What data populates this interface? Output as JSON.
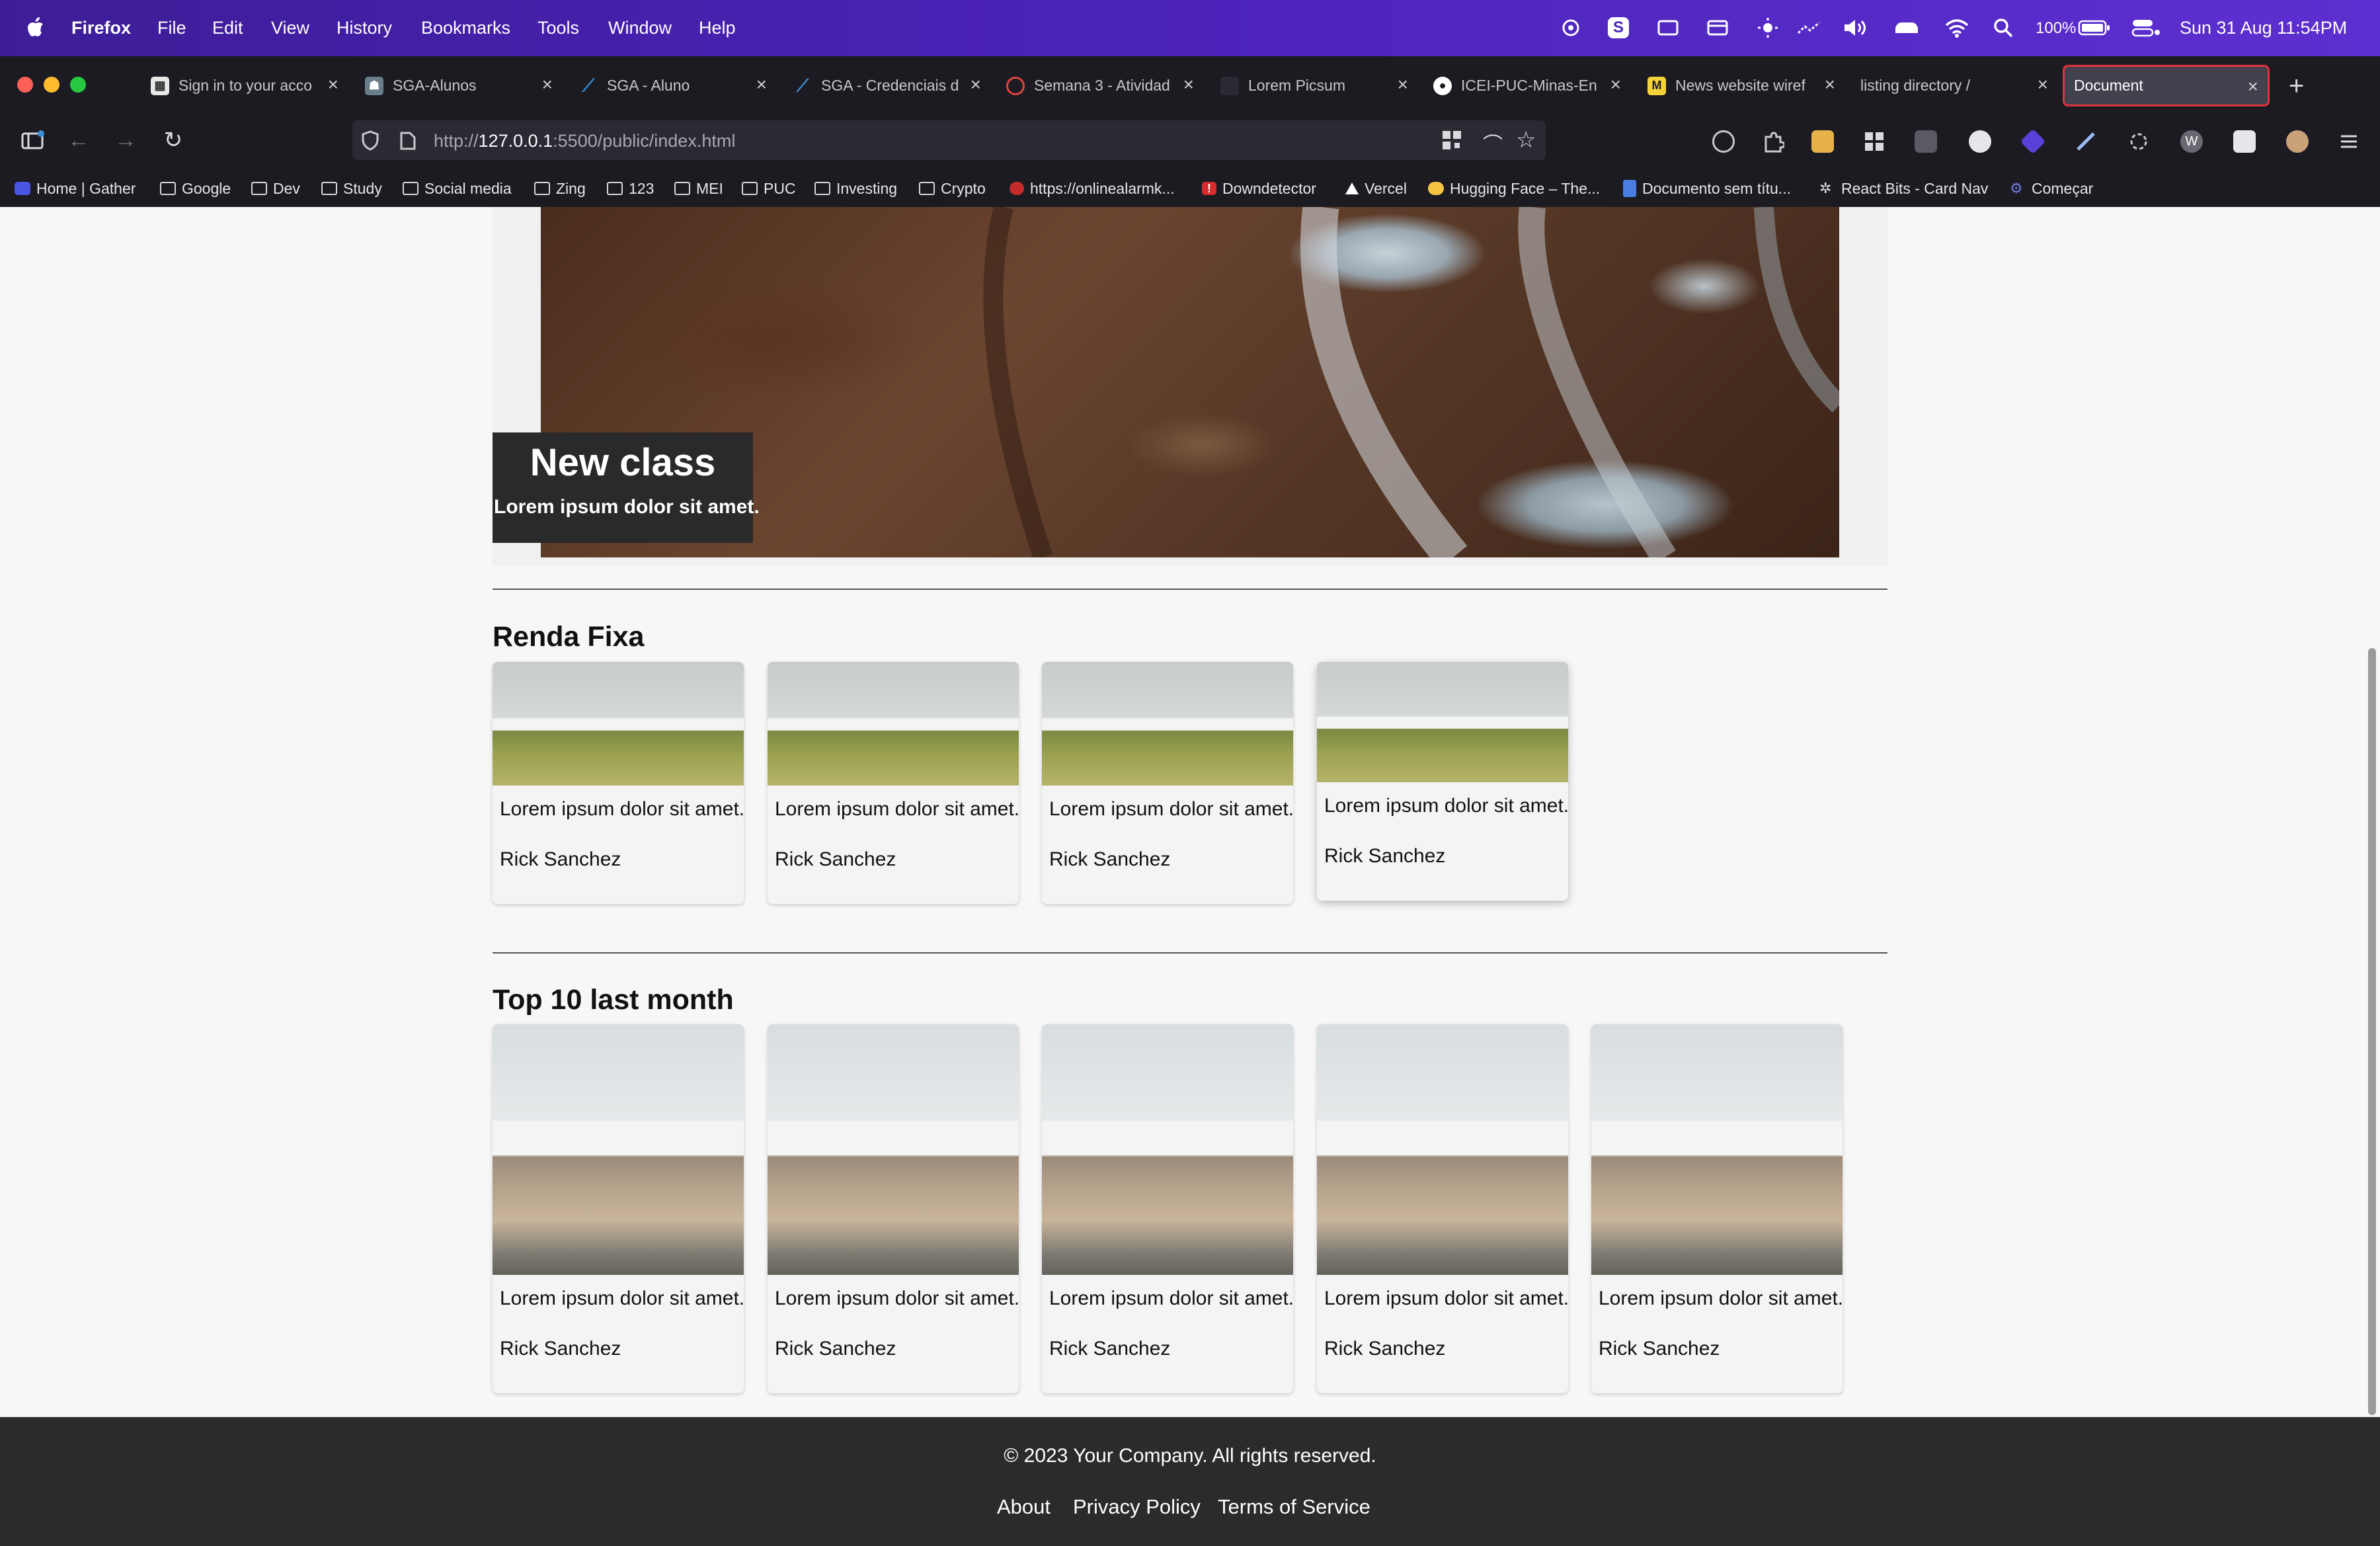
{
  "menubar": {
    "app_name": "Firefox",
    "items": [
      "File",
      "Edit",
      "View",
      "History",
      "Bookmarks",
      "Tools",
      "Window",
      "Help"
    ],
    "battery": "100%",
    "datetime": "Sun 31 Aug  11:54PM"
  },
  "tabs": [
    {
      "title": "Sign in to your acco",
      "favicon_color": "#e8e8e8",
      "active": false
    },
    {
      "title": "SGA-Alunos",
      "favicon_color": "#6a7d8a",
      "active": false
    },
    {
      "title": "SGA - Aluno",
      "favicon_color": "#3a8fd9",
      "active": false
    },
    {
      "title": "SGA - Credenciais d",
      "favicon_color": "#3a8fd9",
      "active": false
    },
    {
      "title": "Semana 3 - Atividad",
      "favicon_color": "#e0463b",
      "active": false
    },
    {
      "title": "Lorem Picsum",
      "favicon_color": "#1c1b22",
      "active": false
    },
    {
      "title": "ICEI-PUC-Minas-En",
      "favicon_color": "#ffffff",
      "active": false
    },
    {
      "title": "News website wiref",
      "favicon_color": "#f5d23a",
      "active": false
    },
    {
      "title": "listing directory /",
      "favicon_color": "#1c1b22",
      "active": false
    },
    {
      "title": "Document",
      "favicon_color": "#1c1b22",
      "active": true
    }
  ],
  "url": {
    "prefix": "http://",
    "host": "127.0.0.1",
    "rest": ":5500/public/index.html"
  },
  "bookmarks": [
    {
      "label": "Home | Gather",
      "icon": "gather-icon",
      "color": "#4a56e2"
    },
    {
      "label": "Google",
      "icon": "folder-icon"
    },
    {
      "label": "Dev",
      "icon": "folder-icon"
    },
    {
      "label": "Study",
      "icon": "folder-icon"
    },
    {
      "label": "Social media",
      "icon": "folder-icon"
    },
    {
      "label": "Zing",
      "icon": "folder-icon"
    },
    {
      "label": "123",
      "icon": "folder-icon"
    },
    {
      "label": "MEI",
      "icon": "folder-icon"
    },
    {
      "label": "PUC",
      "icon": "folder-icon"
    },
    {
      "label": "Investing",
      "icon": "folder-icon"
    },
    {
      "label": "Crypto",
      "icon": "folder-icon"
    },
    {
      "label": "https://onlinealarmk...",
      "icon": "alarm-icon",
      "color": "#c42b2b"
    },
    {
      "label": "Downdetector",
      "icon": "alert-icon",
      "color": "#d92b2b"
    },
    {
      "label": "Vercel",
      "icon": "vercel-icon",
      "color": "#ffffff"
    },
    {
      "label": "Hugging Face – The...",
      "icon": "hugging-face-icon",
      "color": "#f5c542"
    },
    {
      "label": "Documento sem títu...",
      "icon": "docs-icon",
      "color": "#4a7de2"
    },
    {
      "label": "React Bits - Card Nav",
      "icon": "react-bits-icon",
      "color": "#dddddd"
    },
    {
      "label": "Começar",
      "icon": "gear-icon",
      "color": "#6b7cd9"
    }
  ],
  "hero": {
    "title": "New class",
    "subtitle": "Lorem ipsum dolor sit amet."
  },
  "sections": [
    {
      "title": "Renda Fixa",
      "cards": [
        {
          "desc": "Lorem ipsum dolor sit amet.",
          "author": "Rick Sanchez"
        },
        {
          "desc": "Lorem ipsum dolor sit amet.",
          "author": "Rick Sanchez"
        },
        {
          "desc": "Lorem ipsum dolor sit amet.",
          "author": "Rick Sanchez"
        },
        {
          "desc": "Lorem ipsum dolor sit amet.",
          "author": "Rick Sanchez"
        }
      ]
    },
    {
      "title": "Top 10 last month",
      "cards": [
        {
          "desc": "Lorem ipsum dolor sit amet.",
          "author": "Rick Sanchez"
        },
        {
          "desc": "Lorem ipsum dolor sit amet.",
          "author": "Rick Sanchez"
        },
        {
          "desc": "Lorem ipsum dolor sit amet.",
          "author": "Rick Sanchez"
        },
        {
          "desc": "Lorem ipsum dolor sit amet.",
          "author": "Rick Sanchez"
        },
        {
          "desc": "Lorem ipsum dolor sit amet.",
          "author": "Rick Sanchez"
        }
      ]
    }
  ],
  "footer": {
    "copyright": "© 2023 Your Company. All rights reserved.",
    "links": [
      "About",
      "Privacy Policy",
      "Terms of Service"
    ]
  }
}
